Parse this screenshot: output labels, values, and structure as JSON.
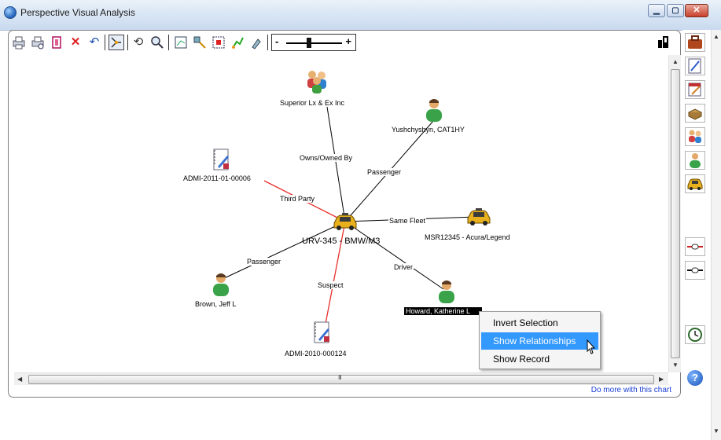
{
  "window": {
    "title": "Perspective Visual Analysis"
  },
  "toolbar": {
    "icons": [
      "print-icon",
      "print-preview-icon",
      "copy-icon",
      "delete-icon",
      "undo-icon",
      "select-tool-icon",
      "lasso-icon",
      "zoom-tool-icon",
      "layout-icon",
      "expand-icon",
      "select-all-icon",
      "paint-icon",
      "brush-icon"
    ],
    "zoom_minus": "-",
    "zoom_plus": "+",
    "zoom_level": 0.4
  },
  "graph": {
    "nodes": [
      {
        "id": "superior",
        "label": "Superior Lx & Ex Inc",
        "icon": "organization"
      },
      {
        "id": "yushchyshyn",
        "label": "Yushchyshyn, CAT1HY",
        "icon": "person"
      },
      {
        "id": "admi2011",
        "label": "ADMI-2011-01-00006",
        "icon": "document"
      },
      {
        "id": "urv345",
        "label": "URV-345 - BMW/M3",
        "icon": "vehicle"
      },
      {
        "id": "msr12345",
        "label": "MSR12345 - Acura/Legend",
        "icon": "vehicle"
      },
      {
        "id": "brown",
        "label": "Brown, Jeff L",
        "icon": "person"
      },
      {
        "id": "howard",
        "label": "Howard, Katherine L",
        "icon": "person"
      },
      {
        "id": "admi2010",
        "label": "ADMI-2010-000124",
        "icon": "document"
      }
    ],
    "edges": [
      {
        "from": "urv345",
        "to": "superior",
        "label": "Owns/Owned By"
      },
      {
        "from": "urv345",
        "to": "yushchyshyn",
        "label": "Passenger"
      },
      {
        "from": "urv345",
        "to": "admi2011",
        "label": "Third Party"
      },
      {
        "from": "urv345",
        "to": "msr12345",
        "label": "Same Fleet"
      },
      {
        "from": "urv345",
        "to": "brown",
        "label": "Passenger"
      },
      {
        "from": "urv345",
        "to": "admi2010",
        "label": "Suspect"
      },
      {
        "from": "urv345",
        "to": "howard",
        "label": "Driver"
      }
    ]
  },
  "context_menu": {
    "items": [
      "Invert Selection",
      "Show Relationships",
      "Show Record"
    ],
    "active_index": 1
  },
  "scrollbar": {
    "grip": "III"
  },
  "footer": {
    "link": "Do more with this chart"
  },
  "sidebar": {
    "icons": [
      "briefcase-icon",
      "edit-icon",
      "calendar-edit-icon",
      "package-icon",
      "group-icon",
      "person-icon",
      "vehicle-icon",
      "link-red-icon",
      "link-black-icon",
      "clock-icon",
      "help-icon"
    ],
    "help_label": "?"
  },
  "colors": {
    "accent": "#3399ff",
    "red_edge": "#e8302c",
    "link": "#1a3fd6"
  }
}
